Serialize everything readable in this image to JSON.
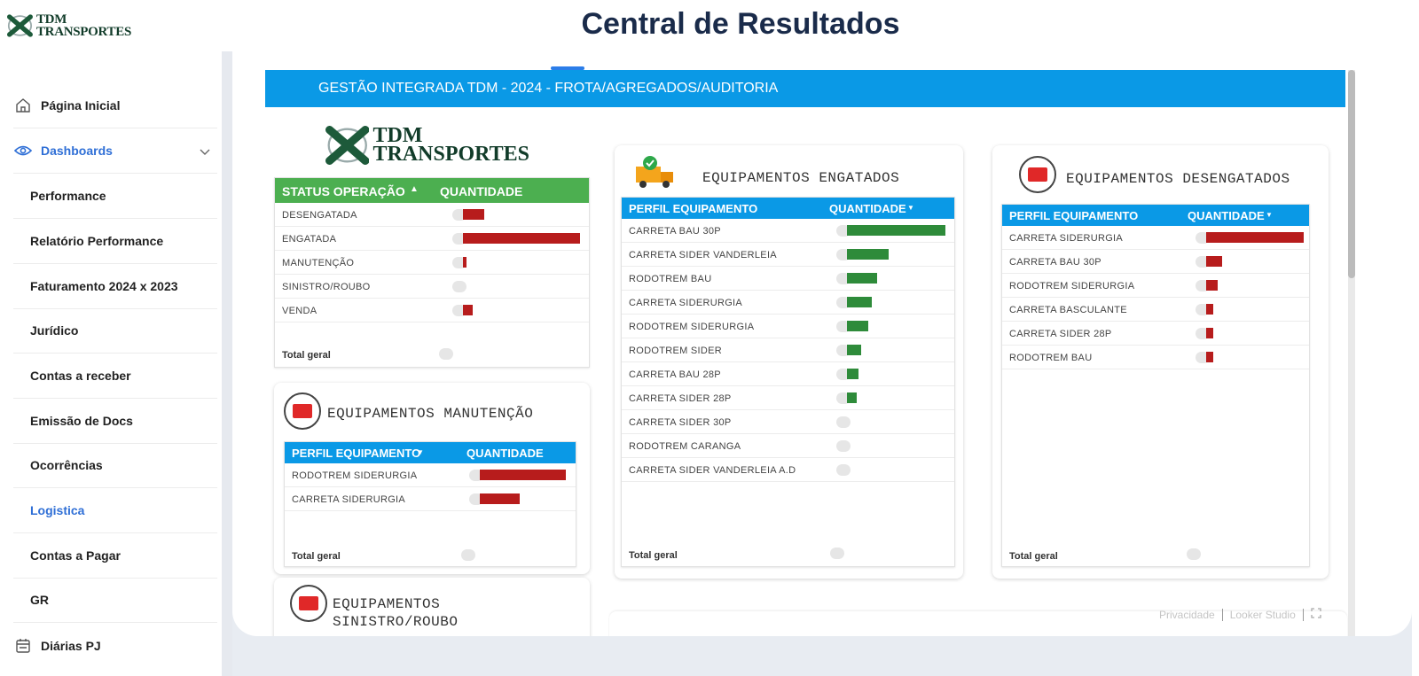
{
  "app": {
    "logo_line1": "TDM",
    "logo_line2": "TRANSPORTES",
    "page_title": "Central de Resultados"
  },
  "sidebar": {
    "items": [
      {
        "label": "Página Inicial"
      },
      {
        "label": "Dashboards"
      },
      {
        "label": "Performance"
      },
      {
        "label": "Relatório Performance"
      },
      {
        "label": "Faturamento 2024 x 2023"
      },
      {
        "label": "Jurídico"
      },
      {
        "label": "Contas a receber"
      },
      {
        "label": "Emissão de Docs"
      },
      {
        "label": "Ocorrências"
      },
      {
        "label": "Logistica"
      },
      {
        "label": "Contas a Pagar"
      },
      {
        "label": "GR"
      },
      {
        "label": "Diárias PJ"
      }
    ],
    "active_color": "#2f6fd6"
  },
  "report": {
    "banner": "GESTÃO INTEGRADA TDM - 2024 - FROTA/AGREGADOS/AUDITORIA",
    "banner_color": "#0a99e6",
    "logo_line1": "TDM",
    "logo_line2": "TRANSPORTES",
    "status_table": {
      "col1": "STATUS OPERAÇÃO",
      "col2": "QUANTIDADE",
      "rows": [
        {
          "label": "DESENGATADA",
          "value": 0.18
        },
        {
          "label": "ENGATADA",
          "value": 1.0
        },
        {
          "label": "MANUTENÇÃO",
          "value": 0.03
        },
        {
          "label": "SINISTRO/ROUBO",
          "value": 0.01
        },
        {
          "label": "VENDA",
          "value": 0.08
        }
      ],
      "total_label": "Total geral"
    },
    "manutencao": {
      "title": "EQUIPAMENTOS MANUTENÇÃO",
      "col1": "PERFIL EQUIPAMENTO",
      "col2": "QUANTIDADE",
      "rows": [
        {
          "label": "RODOTREM SIDERURGIA",
          "value": 1.0
        },
        {
          "label": "CARRETA SIDERURGIA",
          "value": 0.46
        }
      ],
      "total_label": "Total geral"
    },
    "sinistro": {
      "title_line1": "EQUIPAMENTOS",
      "title_line2": "SINISTRO/ROUBO"
    },
    "engatados": {
      "title": "EQUIPAMENTOS ENGATADOS",
      "col1": "PERFIL EQUIPAMENTO",
      "col2": "QUANTIDADE",
      "rows": [
        {
          "label": "CARRETA BAU 30P",
          "value": 1.0
        },
        {
          "label": "CARRETA SIDER VANDERLEIA",
          "value": 0.42
        },
        {
          "label": "RODOTREM BAU",
          "value": 0.31
        },
        {
          "label": "CARRETA SIDERURGIA",
          "value": 0.25
        },
        {
          "label": "RODOTREM SIDERURGIA",
          "value": 0.22
        },
        {
          "label": "RODOTREM SIDER",
          "value": 0.14
        },
        {
          "label": "CARRETA BAU 28P",
          "value": 0.12
        },
        {
          "label": "CARRETA SIDER 28P",
          "value": 0.1
        },
        {
          "label": "CARRETA SIDER 30P",
          "value": 0.02
        },
        {
          "label": "RODOTREM CARANGA",
          "value": 0.01
        },
        {
          "label": "CARRETA SIDER VANDERLEIA A.D",
          "value": 0.01
        }
      ],
      "total_label": "Total geral"
    },
    "desengatados": {
      "title": "EQUIPAMENTOS DESENGATADOS",
      "col1": "PERFIL EQUIPAMENTO",
      "col2": "QUANTIDADE",
      "rows": [
        {
          "label": "CARRETA SIDERURGIA",
          "value": 1.0
        },
        {
          "label": "CARRETA BAU 30P",
          "value": 0.16
        },
        {
          "label": "RODOTREM SIDERURGIA",
          "value": 0.12
        },
        {
          "label": "CARRETA BASCULANTE",
          "value": 0.07
        },
        {
          "label": "CARRETA SIDER 28P",
          "value": 0.07
        },
        {
          "label": "RODOTREM BAU",
          "value": 0.07
        }
      ],
      "total_label": "Total geral"
    },
    "colors": {
      "green_header": "#4caf50",
      "blue_header": "#0a99e6",
      "red_bar": "#b71c1c",
      "green_bar": "#2e8b3a"
    },
    "footer": {
      "privacy": "Privacidade",
      "brand": "Looker Studio"
    }
  }
}
